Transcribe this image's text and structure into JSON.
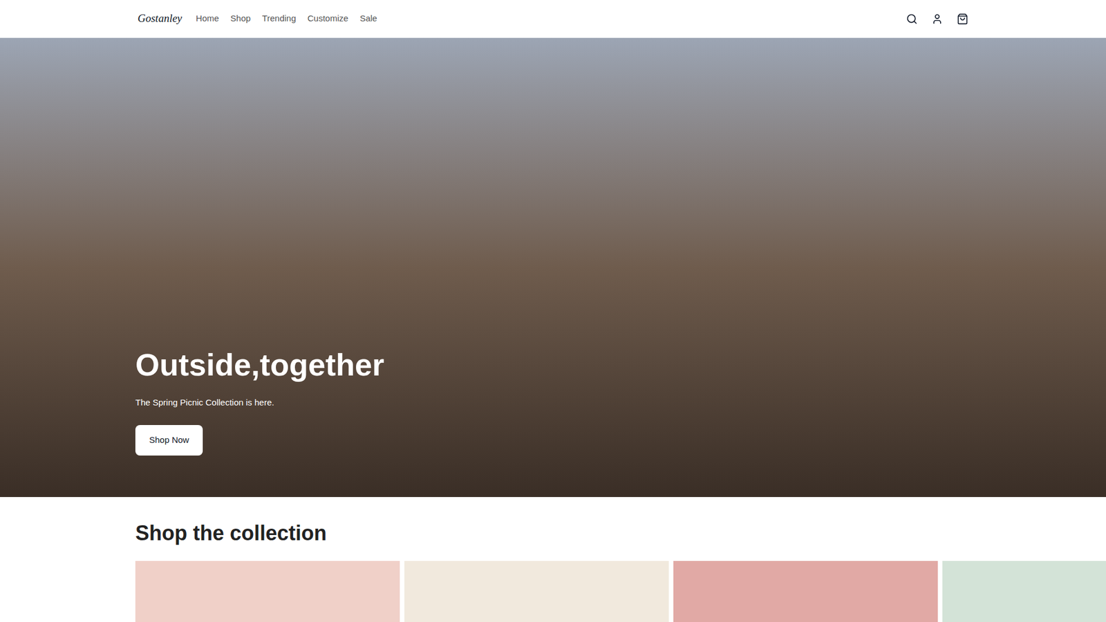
{
  "nav": {
    "logo": "Gostanley",
    "links": [
      "Home",
      "Shop",
      "Trending",
      "Customize",
      "Sale"
    ]
  },
  "hero": {
    "heading": "Outside,together",
    "subtitle": "The Spring Picnic Collection is here.",
    "button": "Shop Now"
  },
  "collection": {
    "title": "Shop the collection",
    "cards": [
      {
        "color": "#f0d0c8"
      },
      {
        "color": "#f1e9dd"
      },
      {
        "color": "#e1a9a5"
      },
      {
        "color": "#d3e3d7"
      }
    ]
  }
}
